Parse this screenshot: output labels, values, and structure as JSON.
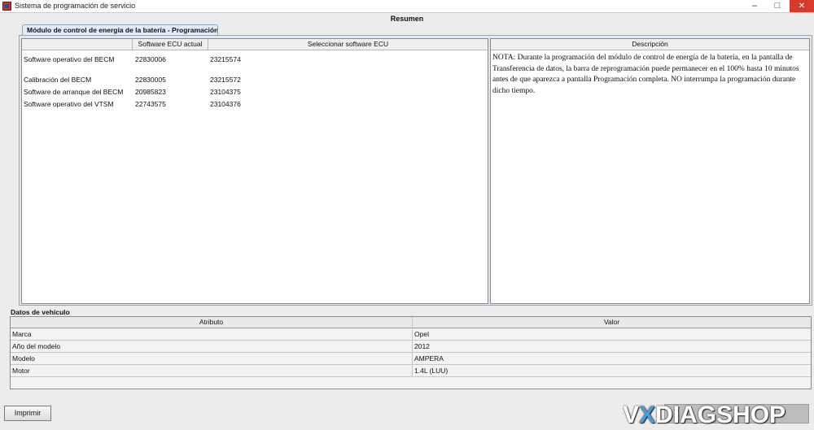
{
  "window": {
    "title": "Sistema de programación de servicio",
    "minimize_glyph": "–",
    "maximize_glyph": "□",
    "close_glyph": "✕"
  },
  "header": {
    "title": "Resumen"
  },
  "tab": {
    "label": "Módulo de control de energía de la batería - Programación"
  },
  "programming_table": {
    "columns": [
      "",
      "Software ECU actual",
      "Seleccionar software ECU"
    ],
    "rows": [
      {
        "name": "Software operativo del BECM",
        "current": "22830006",
        "selected": "23215574"
      },
      {
        "name": "Calibración del BECM",
        "current": "22830005",
        "selected": "23215572"
      },
      {
        "name": "Software de arranque del BECM",
        "current": "20985823",
        "selected": "23104375"
      },
      {
        "name": "Software operativo del VTSM",
        "current": "22743575",
        "selected": "23104376"
      }
    ]
  },
  "description": {
    "header": "Descripción",
    "text": "NOTA: Durante la programación del módulo de control de energía de la batería, en la pantalla de Transferencia de datos, la barra de reprogramación puede permanecer en el 100% hasta 10 minutos antes de que aparezca a pantalla Programación completa. NO interrumpa la programación durante dicho tiempo."
  },
  "vehicle_data": {
    "title": "Datos de vehículo",
    "columns": [
      "Atributo",
      "Valor"
    ],
    "rows": [
      {
        "attribute": "Marca",
        "value": "Opel"
      },
      {
        "attribute": "Año del modelo",
        "value": "2012"
      },
      {
        "attribute": "Modelo",
        "value": "AMPERA"
      },
      {
        "attribute": "Motor",
        "value": "1.4L (LUU)"
      }
    ]
  },
  "footer": {
    "print_label": "Imprimir"
  },
  "watermark": {
    "part1": "V",
    "part2": "X",
    "part3": "DIAGSHOP"
  }
}
